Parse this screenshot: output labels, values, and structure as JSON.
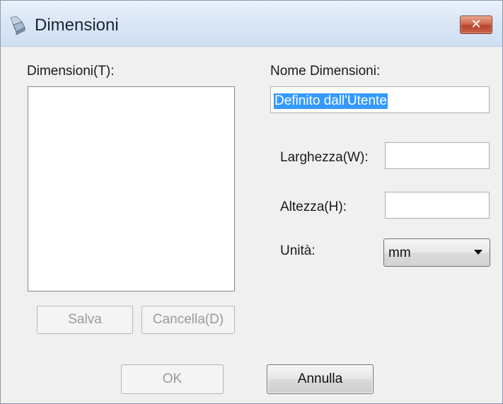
{
  "window": {
    "title": "Dimensioni"
  },
  "left": {
    "list_label": "Dimensioni(T):",
    "items": [],
    "save_label": "Salva",
    "delete_label": "Cancella(D)"
  },
  "right": {
    "name_label": "Nome Dimensioni:",
    "name_value": "Definito dall'Utente",
    "width_label": "Larghezza(W):",
    "width_value": "",
    "height_label": "Altezza(H):",
    "height_value": "",
    "unit_label": "Unità:",
    "unit_value": "mm"
  },
  "footer": {
    "ok_label": "OK",
    "cancel_label": "Annulla"
  },
  "icons": {
    "title": "scanner-icon",
    "close": "close-icon",
    "dropdown": "chevron-down-icon"
  },
  "colors": {
    "selection": "#3399ff",
    "close_button": "#c45a40"
  }
}
